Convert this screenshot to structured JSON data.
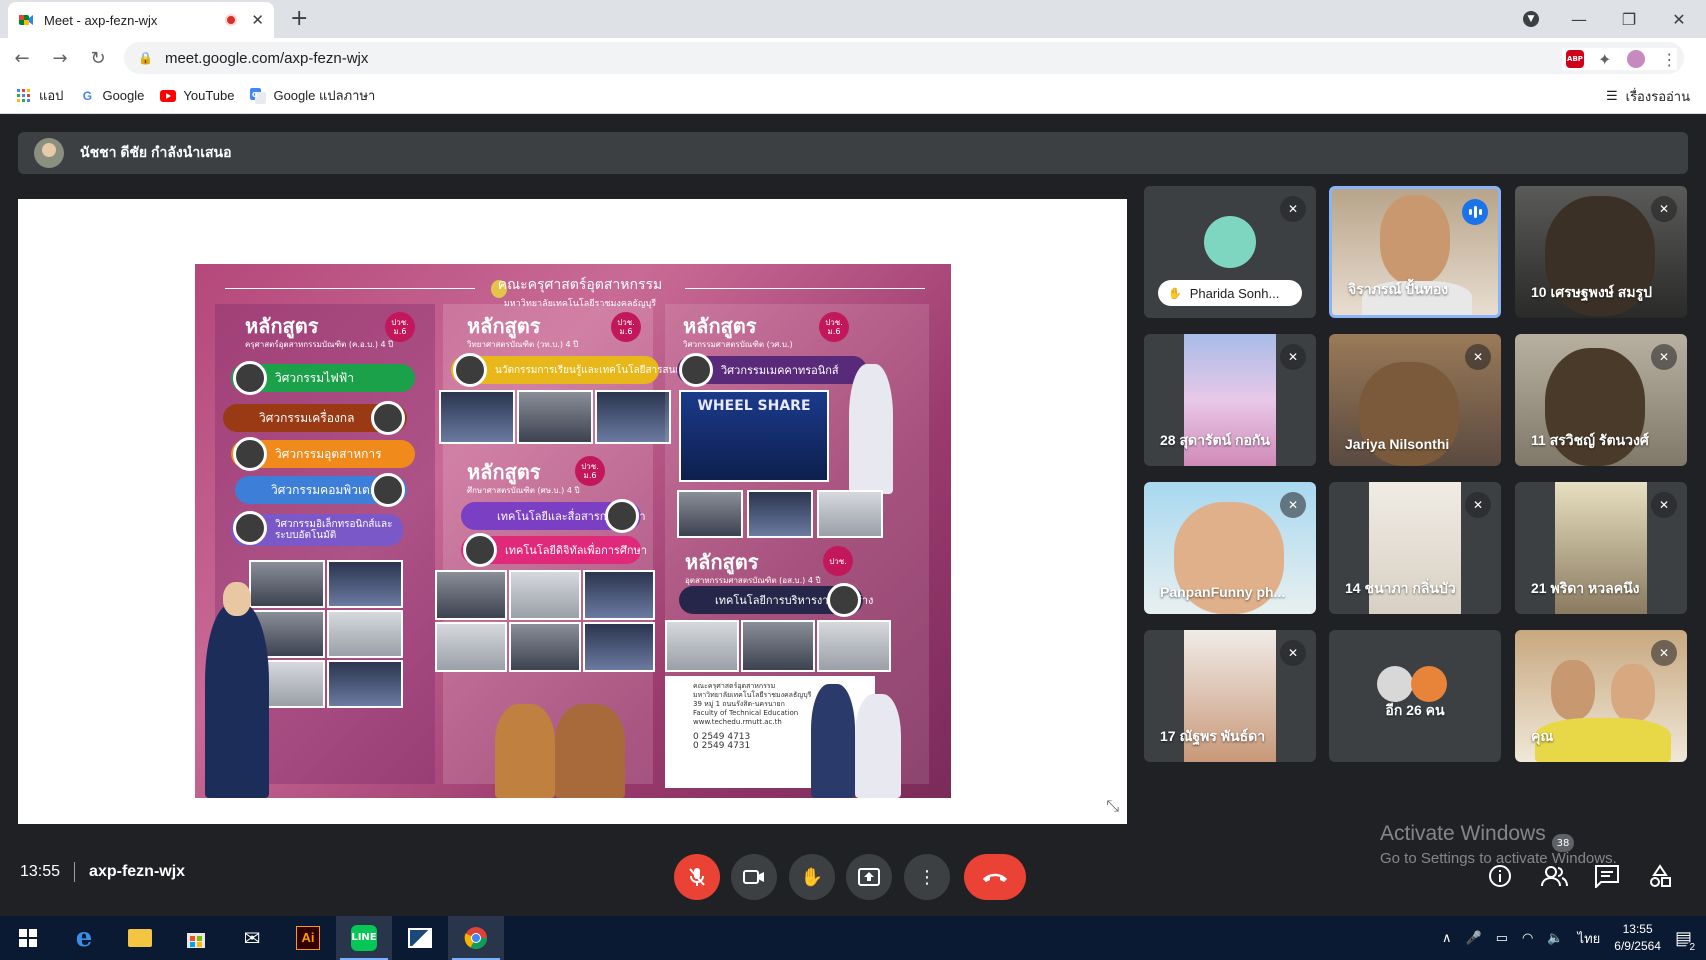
{
  "browser": {
    "tab_title": "Meet - axp-fezn-wjx",
    "url": "meet.google.com/axp-fezn-wjx",
    "bookmarks": [
      {
        "label": "แอป",
        "icon": "apps-grid-icon"
      },
      {
        "label": "Google",
        "icon": "google-icon"
      },
      {
        "label": "YouTube",
        "icon": "youtube-icon"
      },
      {
        "label": "Google แปลภาษา",
        "icon": "google-translate-icon"
      }
    ],
    "reading_list": "เรื่องรออ่าน",
    "abp_label": "ABP"
  },
  "presenter": {
    "label": "นัชชา ดีชัย กำลังนำเสนอ"
  },
  "slide": {
    "header_title": "คณะครุศาสตร์อุตสาหกรรม",
    "header_sub": "มหาวิทยาลัยเทคโนโลยีราชมงคลธัญบุรี",
    "col1_title": "หลักสูตร",
    "col1_sub": "ครุศาสตร์อุตสาหกรรมบัณฑิต (ค.อ.บ.) 4 ปี",
    "col1_badge": "ปวช. ม.6",
    "col1_pills": [
      "วิศวกรรมไฟฟ้า",
      "วิศวกรรมเครื่องกล",
      "วิศวกรรมอุตสาหการ",
      "วิศวกรรมคอมพิวเตอร์",
      "วิศวกรรมอิเล็กทรอนิกส์และระบบอัตโนมัติ"
    ],
    "col2_title": "หลักสูตร",
    "col2_sub": "วิทยาศาสตรบัณฑิต (วท.บ.) 4 ปี",
    "col2_badge": "ปวช. ม.6",
    "col2_pill": "นวัตกรรมการเรียนรู้และเทคโนโลยีสารสนเทศ",
    "col2b_title": "หลักสูตร",
    "col2b_sub": "ศึกษาศาสตรบัณฑิต (ศษ.บ.) 4 ปี",
    "col2b_badge": "ปวช. ม.6",
    "col2b_pills": [
      "เทคโนโลยีและสื่อสารการศึกษา",
      "เทคโนโลยีดิจิทัลเพื่อการศึกษา"
    ],
    "col3_title": "หลักสูตร",
    "col3_sub": "วิศวกรรมศาสตรบัณฑิต (วศ.บ.)",
    "col3_badge": "ปวช. ม.6",
    "col3_pill": "วิศวกรรมเมคคาทรอนิกส์",
    "col3_banner": "WHEEL SHARE",
    "col3b_title": "หลักสูตร",
    "col3b_sub": "อุตสาหกรรมศาสตรบัณฑิต (อส.บ.) 4 ปี",
    "col3b_badge": "ปวช.",
    "col3b_pill": "เทคโนโลยีการบริหารงานก่อสร้าง",
    "contact_lines": [
      "คณะครุศาสตร์อุตสาหกรรม",
      "มหาวิทยาลัยเทคโนโลยีราชมงคลธัญบุรี",
      "39 หมู่ 1 ถนนรังสิต-นครนายก",
      "Faculty of Technical Education",
      "www.techedu.rmutt.ac.th"
    ],
    "phones": [
      "0 2549 4713",
      "0 2549 4731"
    ]
  },
  "participants": [
    {
      "name": "Pharida Sonh...",
      "muted": true,
      "chip": true
    },
    {
      "name": "จิราภรณ์ ปั้นทอง",
      "muted": false,
      "speaking": true
    },
    {
      "name": "10 เศรษฐพงษ์ สมรูป",
      "muted": true
    },
    {
      "name": "28 สุดารัตน์ กอกัน",
      "muted": true
    },
    {
      "name": "Jariya Nilsonthi",
      "muted": true
    },
    {
      "name": "11 สรวิชญ์ รัตนวงศ์",
      "muted": true
    },
    {
      "name": "PanpanFunny ph...",
      "muted": true
    },
    {
      "name": "14 ชนาภา กลิ่นบัว",
      "muted": true
    },
    {
      "name": "21 พริดา หวลคนึง",
      "muted": true
    },
    {
      "name": "17 ณัฐพร พันธ์ดา",
      "muted": true
    },
    {
      "name": "อีก 26 คน",
      "muted": false
    },
    {
      "name": "คุณ",
      "muted": true
    }
  ],
  "meeting": {
    "time": "13:55",
    "code": "axp-fezn-wjx",
    "participant_count": "38"
  },
  "watermark": {
    "line1": "Activate Windows",
    "line2": "Go to Settings to activate Windows."
  },
  "taskbar": {
    "lang": "ไทย",
    "time": "13:55",
    "date": "6/9/2564",
    "notifications": "2"
  },
  "colors": {
    "meet_bg": "#202124",
    "panel": "#3c4043",
    "red": "#ea4335",
    "active_border": "#8ab4f8"
  }
}
